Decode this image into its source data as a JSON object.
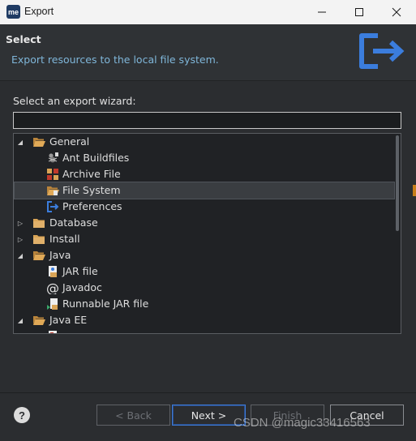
{
  "window": {
    "icon_text": "me",
    "title": "Export"
  },
  "header": {
    "title": "Select",
    "description": "Export resources to the local file system.",
    "logo_icon": "export-arrow-icon"
  },
  "wizard": {
    "label": "Select an export wizard:",
    "filter_value": "",
    "filter_placeholder": ""
  },
  "tree": {
    "items": [
      {
        "label": "General",
        "level": 0,
        "expanded": true,
        "icon": "folder-open-icon"
      },
      {
        "label": "Ant Buildfiles",
        "level": 1,
        "icon": "ant-icon"
      },
      {
        "label": "Archive File",
        "level": 1,
        "icon": "archive-icon"
      },
      {
        "label": "File System",
        "level": 1,
        "icon": "folder-file-icon",
        "selected": true
      },
      {
        "label": "Preferences",
        "level": 1,
        "icon": "preferences-export-icon"
      },
      {
        "label": "Database",
        "level": 0,
        "expanded": false,
        "icon": "folder-icon"
      },
      {
        "label": "Install",
        "level": 0,
        "expanded": false,
        "icon": "folder-icon"
      },
      {
        "label": "Java",
        "level": 0,
        "expanded": true,
        "icon": "folder-open-icon"
      },
      {
        "label": "JAR file",
        "level": 1,
        "icon": "jar-icon"
      },
      {
        "label": "Javadoc",
        "level": 1,
        "icon": "at-icon"
      },
      {
        "label": "Runnable JAR file",
        "level": 1,
        "icon": "runnable-jar-icon"
      },
      {
        "label": "Java EE",
        "level": 0,
        "expanded": true,
        "icon": "folder-open-icon"
      }
    ]
  },
  "buttons": {
    "help": "?",
    "back": "< Back",
    "next": "Next >",
    "finish": "Finish",
    "cancel": "Cancel"
  },
  "watermark": "CSDN @magic33416563",
  "colors": {
    "accent": "#3d7ad6",
    "header_desc": "#7fb6d9",
    "logo": "#3b7ddd",
    "folder": "#d9a456"
  }
}
